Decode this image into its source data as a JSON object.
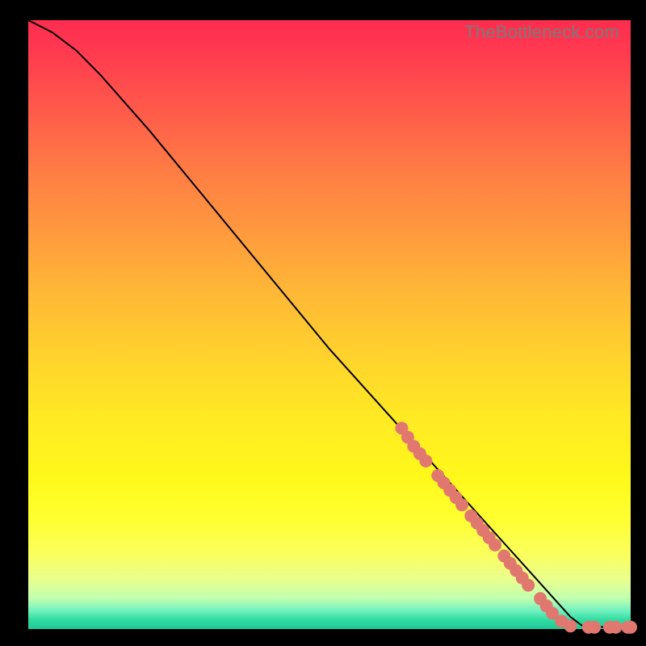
{
  "watermark": "TheBottleneck.com",
  "chart_data": {
    "type": "line",
    "title": "",
    "xlabel": "",
    "ylabel": "",
    "xlim": [
      0,
      100
    ],
    "ylim": [
      0,
      100
    ],
    "series": [
      {
        "name": "curve",
        "x": [
          0,
          4,
          8,
          12,
          20,
          30,
          40,
          50,
          60,
          70,
          80,
          90,
          92,
          96,
          100
        ],
        "y": [
          100,
          98,
          95,
          91,
          82,
          70,
          58,
          46,
          35,
          24,
          13,
          2,
          0.5,
          0.3,
          0.3
        ]
      }
    ],
    "markers": {
      "name": "highlight-segment",
      "color": "#e07870",
      "points_xy": [
        [
          62,
          33
        ],
        [
          63,
          31.5
        ],
        [
          64,
          30
        ],
        [
          65,
          28.8
        ],
        [
          66,
          27.6
        ],
        [
          68,
          25.2
        ],
        [
          69,
          24
        ],
        [
          70,
          22.8
        ],
        [
          71,
          21.6
        ],
        [
          72,
          20.4
        ],
        [
          73.5,
          18.6
        ],
        [
          74.5,
          17.4
        ],
        [
          75.5,
          16.2
        ],
        [
          76.5,
          15
        ],
        [
          77.5,
          13.8
        ],
        [
          79,
          12
        ],
        [
          80,
          10.8
        ],
        [
          81,
          9.6
        ],
        [
          82,
          8.4
        ],
        [
          83,
          7.2
        ],
        [
          85,
          5
        ],
        [
          86,
          3.8
        ],
        [
          87,
          2.6
        ],
        [
          88.5,
          1.3
        ],
        [
          90,
          0.5
        ],
        [
          93,
          0.3
        ],
        [
          94,
          0.3
        ],
        [
          96.5,
          0.3
        ],
        [
          97.5,
          0.3
        ],
        [
          99.5,
          0.3
        ],
        [
          100,
          0.3
        ]
      ]
    }
  }
}
